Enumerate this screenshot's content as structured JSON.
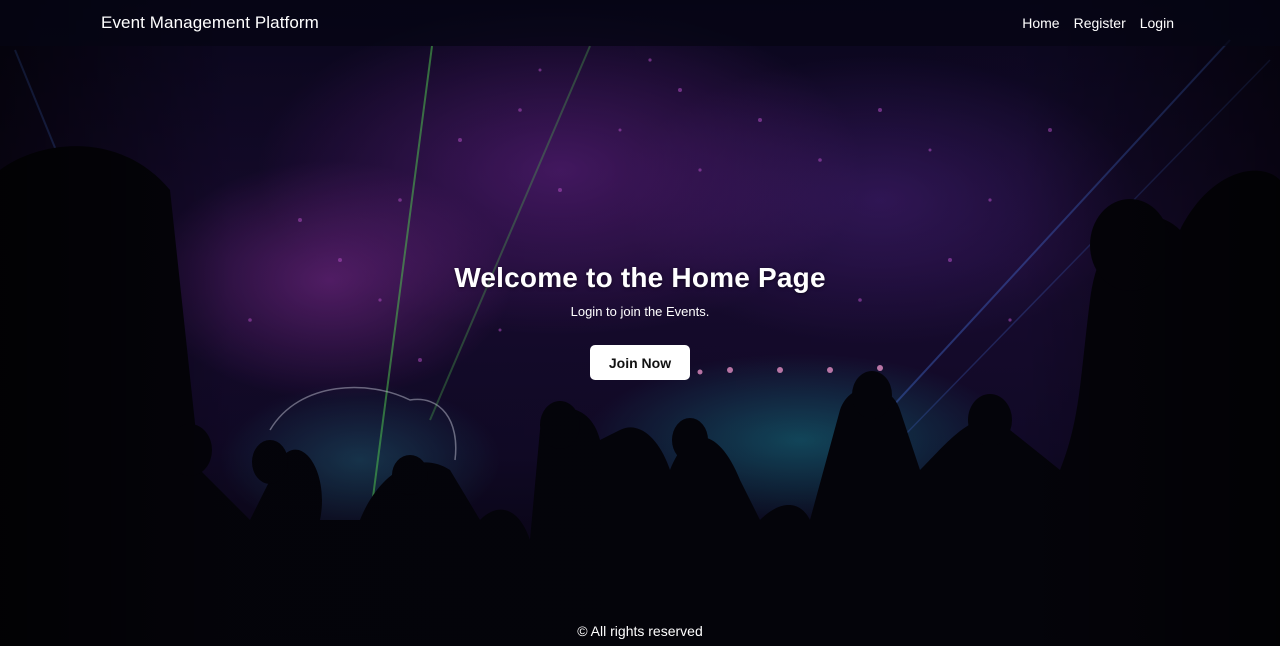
{
  "navbar": {
    "brand": "Event Management Platform",
    "links": [
      {
        "label": "Home"
      },
      {
        "label": "Register"
      },
      {
        "label": "Login"
      }
    ]
  },
  "hero": {
    "title": "Welcome to the Home Page",
    "subtitle": "Login to join the Events.",
    "cta_label": "Join Now",
    "background_image": "concert-crowd-background"
  },
  "footer": {
    "text": "© All rights reserved"
  },
  "colors": {
    "navbar_bg": "#060514",
    "text": "#ffffff",
    "button_bg": "#ffffff",
    "button_text": "#111111"
  }
}
